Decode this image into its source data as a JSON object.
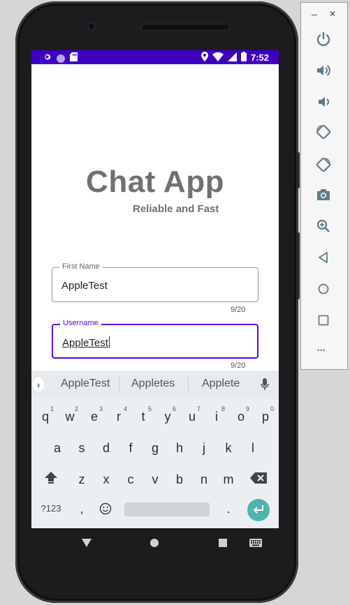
{
  "statusbar": {
    "time": "7:52"
  },
  "app": {
    "title": "Chat App",
    "subtitle": "Reliable and Fast"
  },
  "form": {
    "first_name": {
      "label": "First Name",
      "value": "AppleTest",
      "counter": "9/20"
    },
    "username": {
      "label": "Username",
      "value": "AppleTest",
      "counter": "9/20"
    }
  },
  "keyboard": {
    "suggestions": [
      "AppleTest",
      "Appletes",
      "Applete"
    ],
    "row1": [
      {
        "k": "q",
        "h": "1"
      },
      {
        "k": "w",
        "h": "2"
      },
      {
        "k": "e",
        "h": "3"
      },
      {
        "k": "r",
        "h": "4"
      },
      {
        "k": "t",
        "h": "5"
      },
      {
        "k": "y",
        "h": "6"
      },
      {
        "k": "u",
        "h": "7"
      },
      {
        "k": "i",
        "h": "8"
      },
      {
        "k": "o",
        "h": "9"
      },
      {
        "k": "p",
        "h": "0"
      }
    ],
    "row2": [
      "a",
      "s",
      "d",
      "f",
      "g",
      "h",
      "j",
      "k",
      "l"
    ],
    "row3": [
      "z",
      "x",
      "c",
      "v",
      "b",
      "n",
      "m"
    ],
    "symbols_label": "?123",
    "comma": ",",
    "period": "."
  },
  "toolbar": {
    "minimize": "–",
    "close": "✕",
    "more": "•••"
  },
  "colors": {
    "accent": "#6200ee",
    "statusbar": "#3f00c2",
    "enter": "#4db6ac"
  },
  "icons": [
    "power-icon",
    "volume-up-icon",
    "volume-down-icon",
    "rotate-left-icon",
    "rotate-right-icon",
    "camera-icon",
    "zoom-icon",
    "back-icon",
    "home-icon",
    "overview-icon",
    "more-icon"
  ]
}
